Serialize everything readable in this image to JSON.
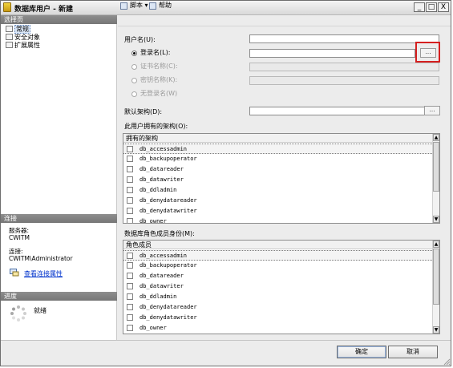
{
  "window": {
    "title": "数据库用户 - 新建",
    "buttons": {
      "minimize": "_",
      "maximize": "□",
      "close": "X"
    }
  },
  "left_panel": {
    "select_page_header": "选择页",
    "pages": [
      {
        "label": "常规",
        "icon": "page-icon",
        "selected": true
      },
      {
        "label": "安全对象",
        "icon": "page-icon",
        "selected": false
      },
      {
        "label": "扩展属性",
        "icon": "page-icon",
        "selected": false
      }
    ],
    "connection_header": "连接",
    "server_label": "服务器:",
    "server_value": "CWITM",
    "connection_label": "连接:",
    "connection_value": "CWITM\\Administrator",
    "view_connection_link": "查看连接属性",
    "progress_header": "进度",
    "status": "就绪"
  },
  "toolbar": {
    "script_label": "脚本 ▾",
    "help_label": "帮助"
  },
  "form": {
    "username_label": "用户名(U):",
    "username_value": "",
    "login_name_label": "登录名(L):",
    "login_name_value": "",
    "certificate_label": "证书名称(C):",
    "key_label": "密钥名称(K):",
    "no_login_label": "无登录名(W)",
    "default_schema_label": "默认架构(D):",
    "default_schema_value": "",
    "browse_label": "...",
    "owned_schemas_label": "此用户拥有的架构(O):",
    "role_members_label": "数据库角色成员身份(M):"
  },
  "owned_schemas": {
    "header": "拥有的架构",
    "items": [
      "db_accessadmin",
      "db_backupoperator",
      "db_datareader",
      "db_datawriter",
      "db_ddladmin",
      "db_denydatareader",
      "db_denydatawriter",
      "db_owner"
    ]
  },
  "role_members": {
    "header": "角色成员",
    "items": [
      "db_accessadmin",
      "db_backupoperator",
      "db_datareader",
      "db_datawriter",
      "db_ddladmin",
      "db_denydatareader",
      "db_denydatawriter",
      "db_owner"
    ]
  },
  "buttons": {
    "ok": "确定",
    "cancel": "取消"
  },
  "colors": {
    "highlight": "#d51f1f",
    "link": "#0033cc",
    "section_header": "#808080"
  }
}
